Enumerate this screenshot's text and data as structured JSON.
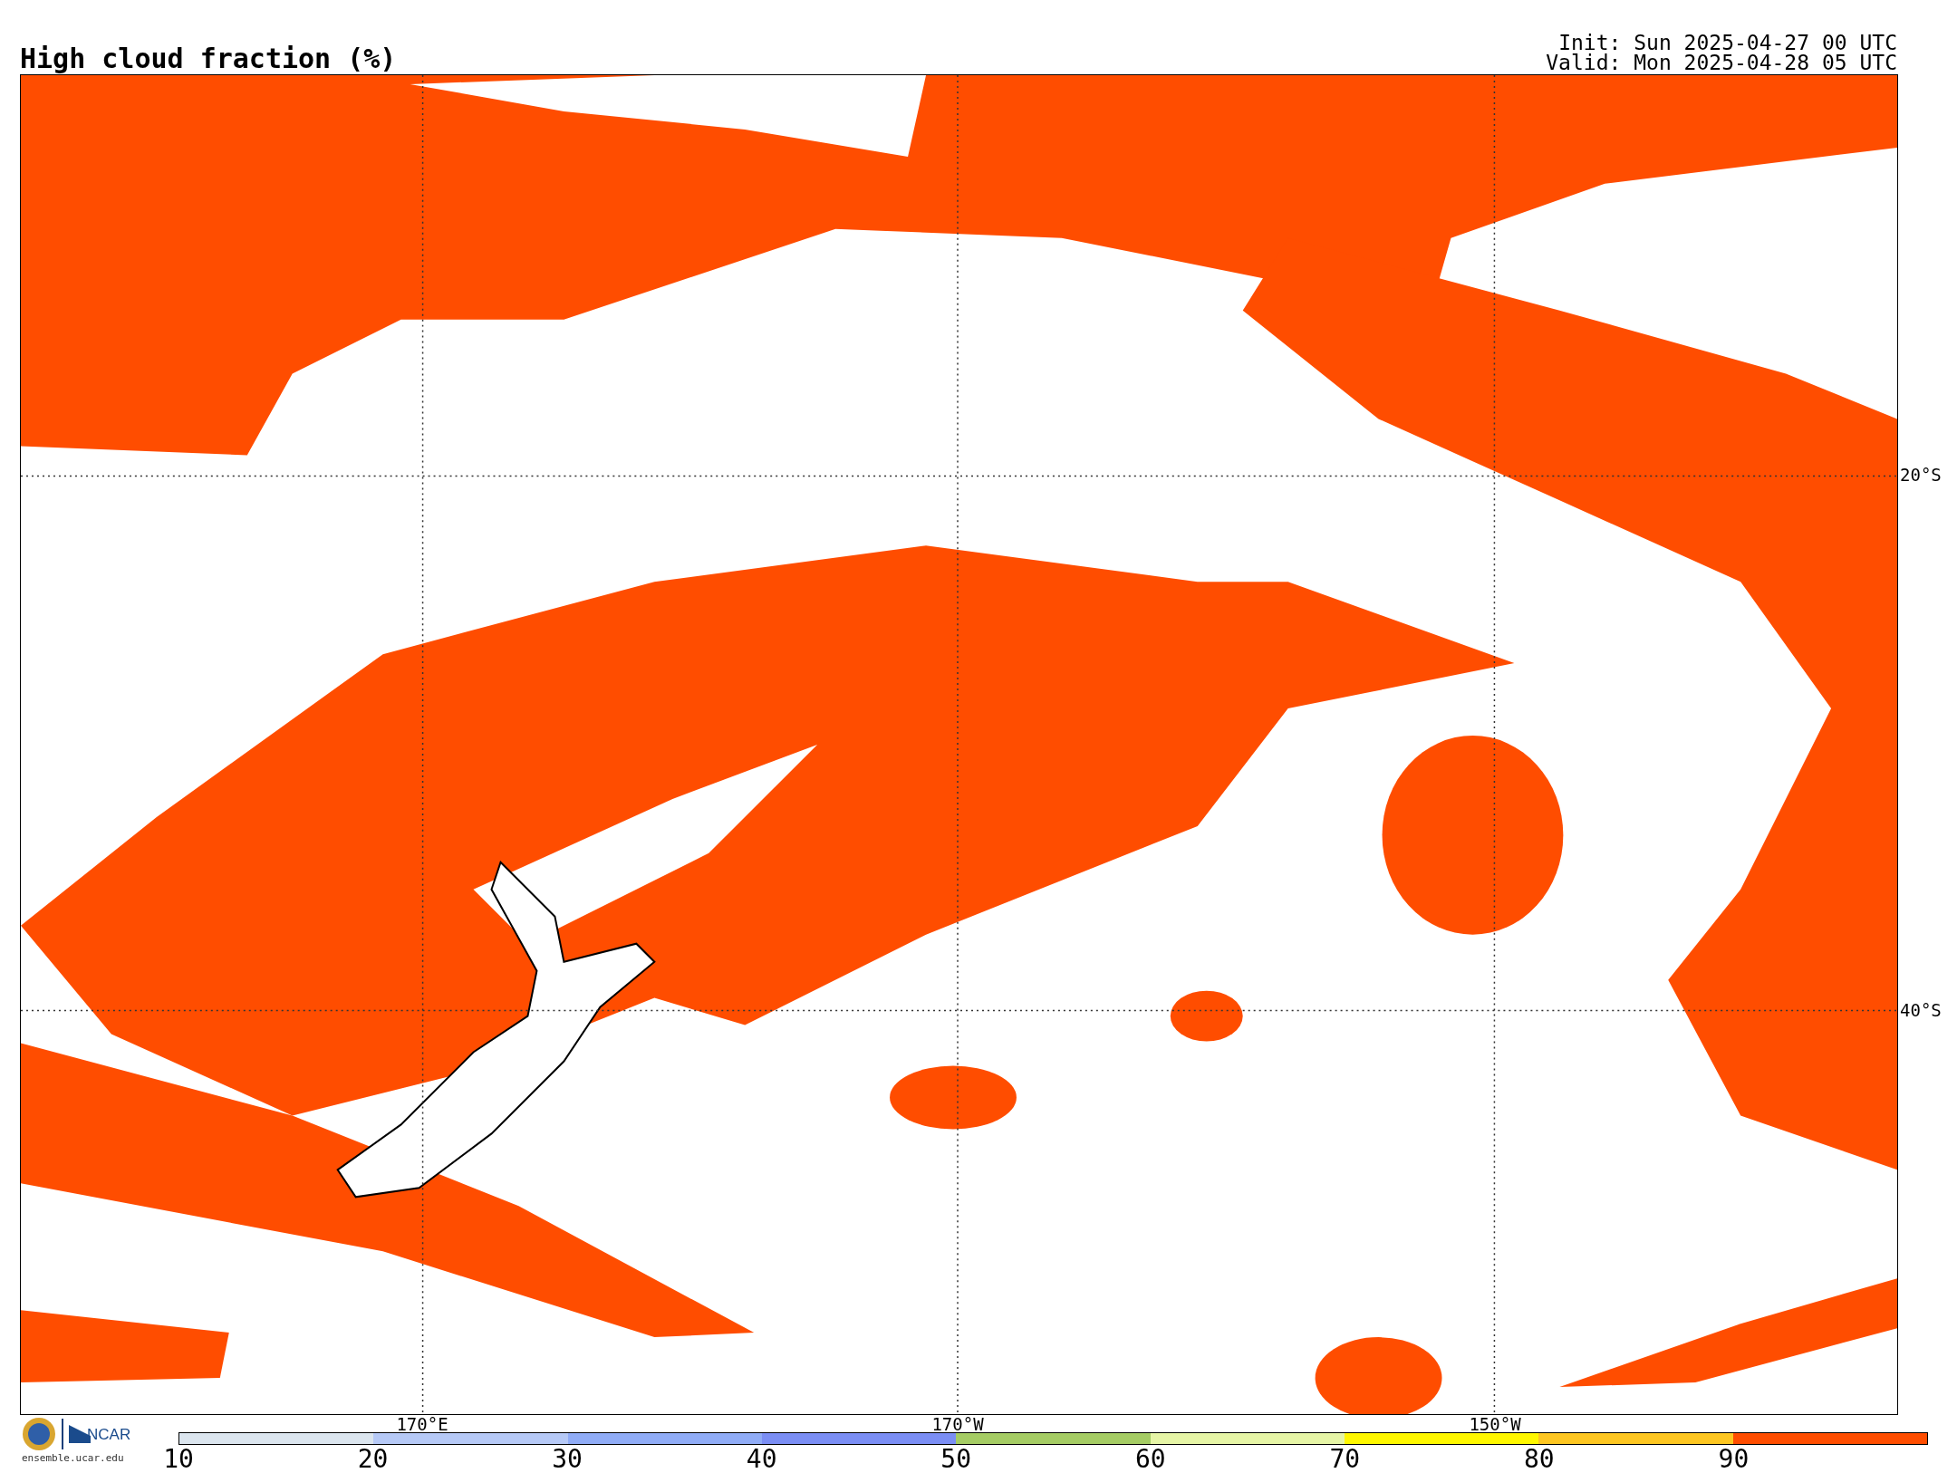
{
  "title": "High cloud fraction (%)",
  "init": "Init: Sun 2025-04-27 00 UTC",
  "valid": "Valid: Mon 2025-04-28 05 UTC",
  "map": {
    "longitude_labels": [
      "170°E",
      "170°W",
      "150°W"
    ],
    "latitude_labels": [
      "20°S",
      "40°S"
    ]
  },
  "colorbar": {
    "segments": [
      {
        "color": "#dbe5ee"
      },
      {
        "color": "#b6c9f6"
      },
      {
        "color": "#90acf6"
      },
      {
        "color": "#7b8ef4"
      },
      {
        "color": "#a5cc64"
      },
      {
        "color": "#e6f5a6"
      },
      {
        "color": "#fff700"
      },
      {
        "color": "#fdc621"
      },
      {
        "color": "#ff4d00"
      }
    ],
    "ticks": [
      "10",
      "20",
      "30",
      "40",
      "50",
      "60",
      "70",
      "80",
      "90"
    ]
  },
  "credits": {
    "logo_text": "NCAR",
    "site": "ensemble.ucar.edu"
  }
}
